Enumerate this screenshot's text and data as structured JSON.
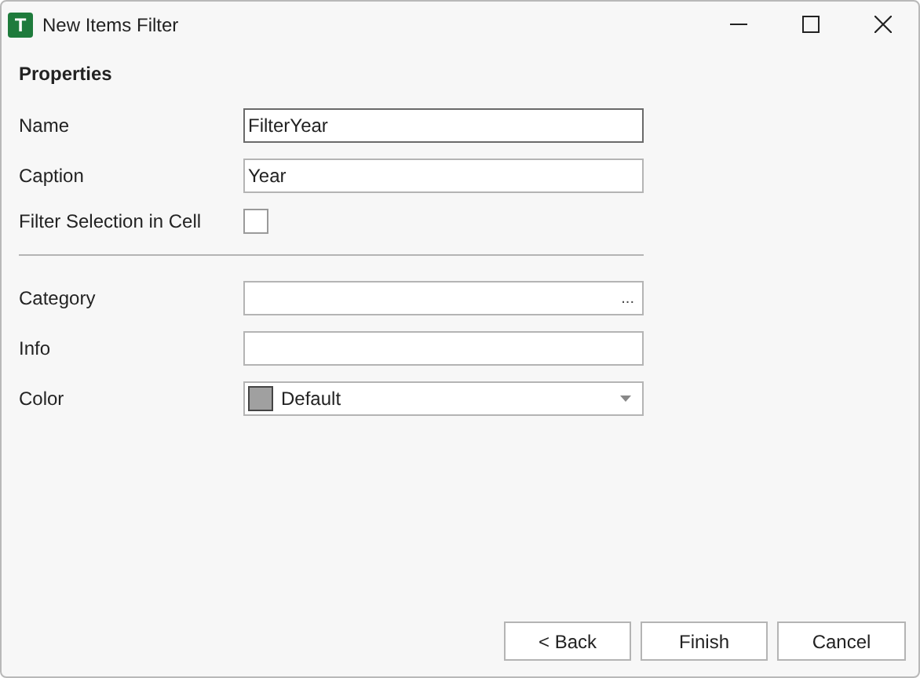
{
  "window": {
    "title": "New Items Filter",
    "app_icon_letter": "T"
  },
  "section_title": "Properties",
  "fields": [
    {
      "kind": "text",
      "label": "Name",
      "value": "FilterYear",
      "focused": true
    },
    {
      "kind": "text",
      "label": "Caption",
      "value": "Year",
      "focused": false
    },
    {
      "kind": "checkbox",
      "label": "Filter Selection in Cell",
      "checked": false
    },
    {
      "kind": "divider"
    },
    {
      "kind": "browse",
      "label": "Category",
      "button": "...",
      "focused": false
    },
    {
      "kind": "text",
      "label": "Info",
      "focused": false
    },
    {
      "kind": "color",
      "label": "Color",
      "value": "Default",
      "color": "#a0a0a0"
    }
  ],
  "buttons": [
    "< Back",
    "Finish",
    "Cancel"
  ]
}
